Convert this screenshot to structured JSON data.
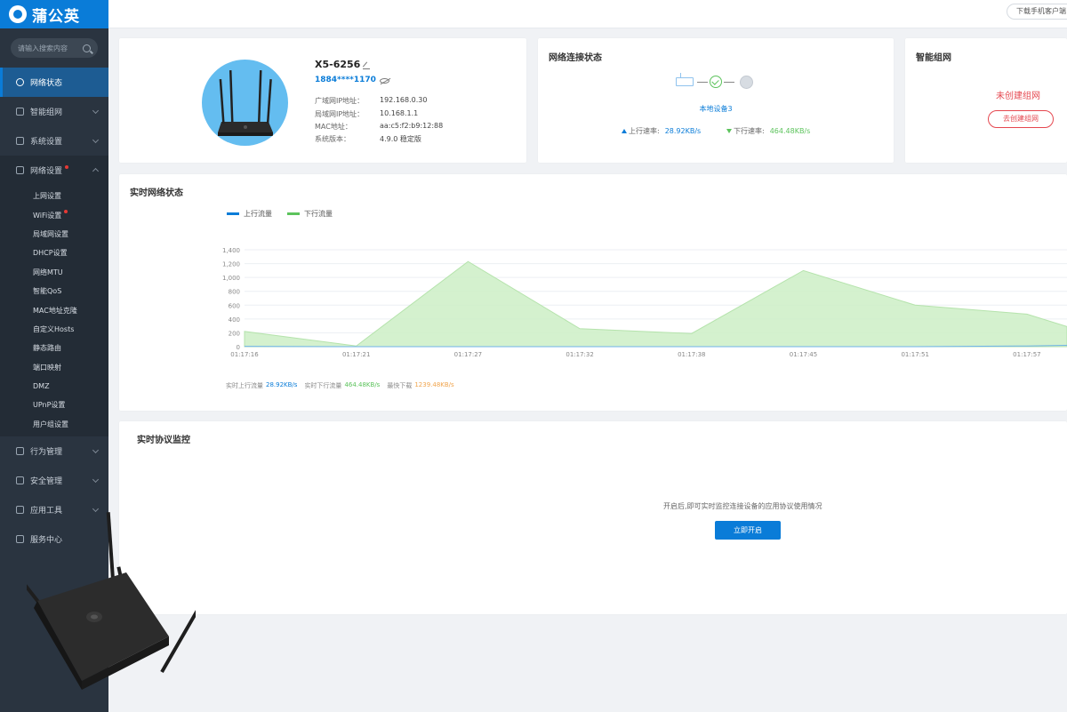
{
  "brand": {
    "name": "蒲公英"
  },
  "search": {
    "placeholder": "请输入搜索内容"
  },
  "sidebar": {
    "items": [
      {
        "label": "网络状态"
      },
      {
        "label": "智能组网"
      },
      {
        "label": "系统设置"
      },
      {
        "label": "网络设置"
      }
    ],
    "subitems": [
      {
        "label": "上网设置"
      },
      {
        "label": "WiFi设置"
      },
      {
        "label": "局域网设置"
      },
      {
        "label": "DHCP设置"
      },
      {
        "label": "网络MTU"
      },
      {
        "label": "智能QoS"
      },
      {
        "label": "MAC地址克隆"
      },
      {
        "label": "自定义Hosts"
      },
      {
        "label": "静态路由"
      },
      {
        "label": "端口映射"
      },
      {
        "label": "DMZ"
      },
      {
        "label": "UPnP设置"
      },
      {
        "label": "用户组设置"
      }
    ],
    "bottom_items": [
      {
        "label": "行为管理"
      },
      {
        "label": "安全管理"
      },
      {
        "label": "应用工具"
      },
      {
        "label": "服务中心"
      }
    ]
  },
  "topbar": {
    "download_label": "下载手机客户端"
  },
  "device": {
    "name": "X5-6256",
    "phone": "1884****1170",
    "rows": [
      {
        "label": "广域网IP地址：",
        "value": "192.168.0.30"
      },
      {
        "label": "局域网IP地址：",
        "value": "10.168.1.1"
      },
      {
        "label": "MAC地址：",
        "value": "aa:c5:f2:b9:12:88"
      },
      {
        "label": "系统版本：",
        "value": "4.9.0 稳定版"
      }
    ]
  },
  "network": {
    "title": "网络连接状态",
    "local_devices": "本地设备3",
    "up_label": "上行速率:",
    "up_value": "28.92KB/s",
    "down_label": "下行速率:",
    "down_value": "464.48KB/s"
  },
  "mesh": {
    "title": "智能组网",
    "status": "未创建组网",
    "button": "去创建组网"
  },
  "realtime": {
    "title": "实时网络状态",
    "stats": {
      "up_label": "实时上行流量",
      "up_value": "28.92KB/s",
      "down_label": "实时下行流量",
      "down_value": "464.48KB/s",
      "max_label": "最快下载",
      "max_value": "1239.48KB/s"
    }
  },
  "protocol": {
    "title": "实时协议监控",
    "description": "开启后,即可实时监控连接设备的应用协议使用情况",
    "button": "立即开启"
  },
  "colors": {
    "accent": "#0a7cd8",
    "download": "#5cc35c",
    "alert": "#e5474f",
    "sidebar": "#2a3440"
  },
  "chart_data": {
    "type": "area",
    "x": [
      "01:17:16",
      "01:17:21",
      "01:17:27",
      "01:17:32",
      "01:17:38",
      "01:17:45",
      "01:17:51",
      "01:17:57"
    ],
    "series": [
      {
        "name": "上行流量",
        "color": "#0a7cd8",
        "values": [
          5,
          0,
          0,
          0,
          0,
          0,
          0,
          10,
          20
        ]
      },
      {
        "name": "下行流量",
        "color": "#5cc35c",
        "values": [
          220,
          10,
          1230,
          260,
          190,
          1100,
          600,
          470,
          290
        ]
      }
    ],
    "yticks": [
      0,
      200,
      400,
      600,
      800,
      "1,000",
      "1,200",
      "1,400"
    ],
    "ylim": [
      0,
      1400
    ]
  }
}
